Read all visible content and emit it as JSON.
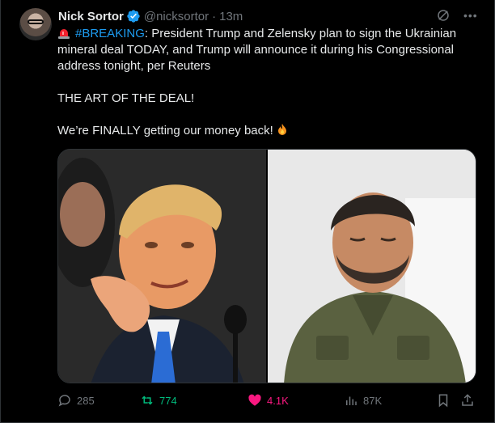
{
  "author": {
    "name": "Nick Sortor",
    "handle": "@nicksortor",
    "separator": "·",
    "time": "13m",
    "verified": true
  },
  "post": {
    "hashtag": "#BREAKING",
    "line1_rest": ": President Trump and Zelensky plan to sign the Ukrainian mineral deal TODAY, and Trump will announce it during his Congressional address tonight, per Reuters",
    "line2": "THE ART OF THE DEAL!",
    "line3": "We’re FINALLY getting our money back!"
  },
  "media": {
    "images": [
      {
        "subject": "Donald Trump gesturing with open hand at a microphone"
      },
      {
        "subject": "Volodymyr Zelensky looking down, eyes closed"
      }
    ]
  },
  "actions": {
    "reply_count": "285",
    "repost_count": "774",
    "like_count": "4.1K",
    "views_count": "87K"
  },
  "colors": {
    "background": "#000000",
    "text": "#e7e9ea",
    "muted": "#71767b",
    "link": "#1d9bf0",
    "repost": "#00ba7c",
    "like": "#f91880",
    "border": "#2f3336"
  },
  "icons": [
    "verified-badge-icon",
    "grok-icon",
    "more-icon",
    "siren-icon",
    "fire-icon",
    "reply-icon",
    "repost-icon",
    "like-icon",
    "views-icon",
    "bookmark-icon",
    "share-icon"
  ]
}
